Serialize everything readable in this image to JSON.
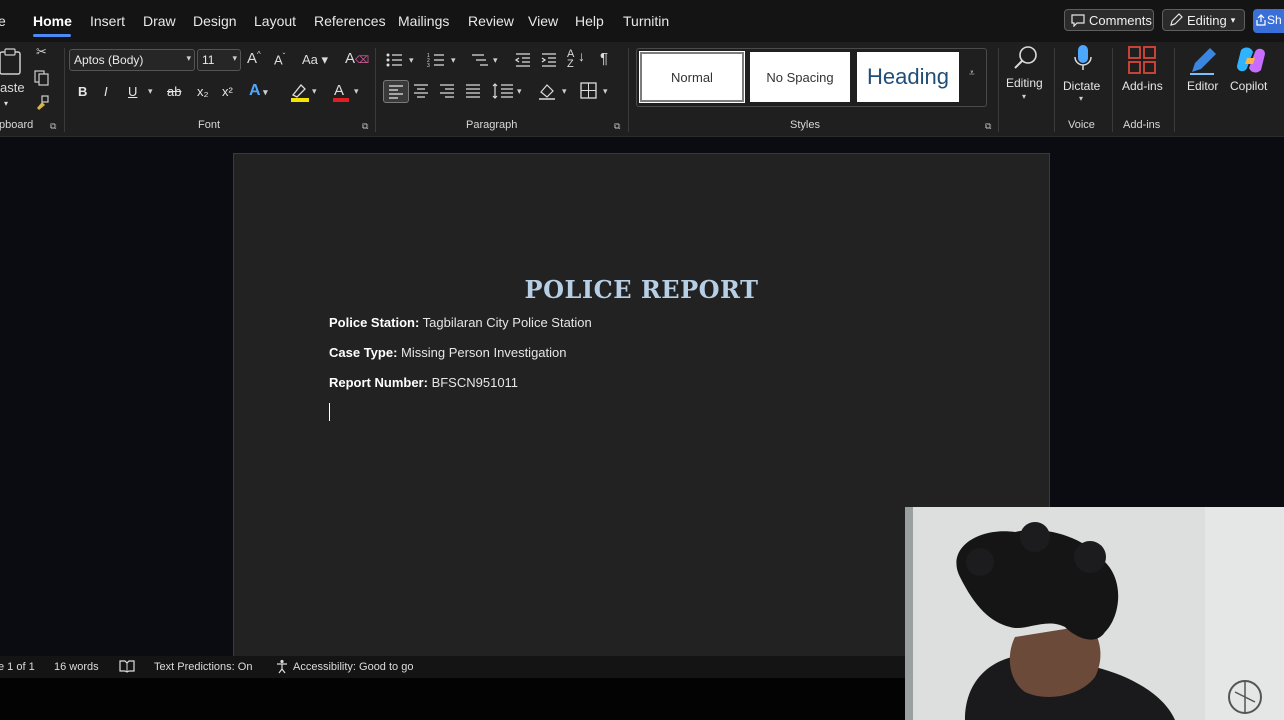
{
  "menu": {
    "tabs": [
      "e",
      "Home",
      "Insert",
      "Draw",
      "Design",
      "Layout",
      "References",
      "Mailings",
      "Review",
      "View",
      "Help",
      "Turnitin"
    ],
    "active_tab": "Home",
    "comments_label": "Comments",
    "editing_label": "Editing",
    "share_label": "Sh"
  },
  "ribbon": {
    "clipboard": {
      "paste_label": "aste",
      "group_label": "pboard"
    },
    "font": {
      "font_name": "Aptos (Body)",
      "font_size": "11",
      "group_label": "Font",
      "buttons": [
        "B",
        "I",
        "U",
        "ab",
        "x₂",
        "x²",
        "A"
      ]
    },
    "paragraph": {
      "group_label": "Paragraph"
    },
    "styles": {
      "items": [
        "Normal",
        "No Spacing",
        "Heading"
      ],
      "group_label": "Styles"
    },
    "editing": {
      "label": "Editing"
    },
    "voice": {
      "dictate_label": "Dictate",
      "group_label": "Voice"
    },
    "addins": {
      "label": "Add-ins",
      "group_label": "Add-ins"
    },
    "editor": {
      "label": "Editor"
    },
    "copilot": {
      "label": "Copilot"
    }
  },
  "document": {
    "title": "POLICE REPORT",
    "lines": [
      {
        "label": "Police Station:",
        "value": " Tagbilaran City Police Station"
      },
      {
        "label": "Case Type:",
        "value": " Missing Person Investigation"
      },
      {
        "label": "Report Number:",
        "value": " BFSCN951011"
      }
    ]
  },
  "status": {
    "page": "e 1 of 1",
    "words": "16 words",
    "predictions": "Text Predictions: On",
    "accessibility": "Accessibility: Good to go"
  },
  "colors": {
    "accent": "#4c8bf5",
    "title": "#b7cfe4",
    "page_bg": "#222222",
    "ribbon_bg": "#1f1f1f"
  }
}
